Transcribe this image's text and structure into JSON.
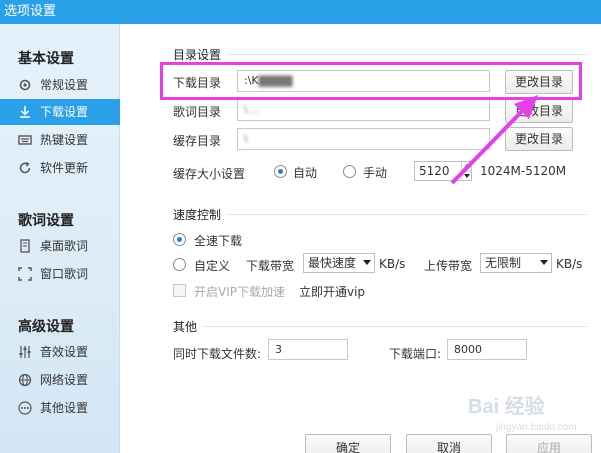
{
  "window": {
    "title": "选项设置"
  },
  "sidebar": {
    "groups": [
      {
        "label": "基本设置",
        "items": [
          {
            "label": "常规设置",
            "icon": "gear-icon"
          },
          {
            "label": "下载设置",
            "icon": "download-icon",
            "active": true
          },
          {
            "label": "热键设置",
            "icon": "keyboard-icon"
          },
          {
            "label": "软件更新",
            "icon": "refresh-icon"
          }
        ]
      },
      {
        "label": "歌词设置",
        "items": [
          {
            "label": "桌面歌词",
            "icon": "desktop-lyrics-icon"
          },
          {
            "label": "窗口歌词",
            "icon": "window-lyrics-icon"
          }
        ]
      },
      {
        "label": "高级设置",
        "items": [
          {
            "label": "音效设置",
            "icon": "equalizer-icon"
          },
          {
            "label": "网络设置",
            "icon": "network-icon"
          },
          {
            "label": "其他设置",
            "icon": "more-icon"
          }
        ]
      }
    ]
  },
  "directory": {
    "section_title": "目录设置",
    "download_label": "下载目录",
    "download_value": ":\\K",
    "lyrics_label": "歌词目录",
    "lyrics_value": "\\ ..",
    "cache_label": "缓存目录",
    "cache_value": "\\",
    "change_button": "更改目录",
    "cache_size_label": "缓存大小设置",
    "auto_label": "自动",
    "manual_label": "手动",
    "cache_size_value": "5120",
    "cache_range": "1024M-5120M"
  },
  "speed": {
    "section_title": "速度控制",
    "full_speed_label": "全速下载",
    "custom_label": "自定义",
    "download_bw_label": "下载带宽",
    "download_bw_value": "最快速度",
    "unit": "KB/s",
    "upload_bw_label": "上传带宽",
    "upload_bw_value": "无限制",
    "vip_label": "开启VIP下载加速",
    "vip_link": "立即开通vip"
  },
  "other": {
    "section_title": "其他",
    "concurrent_label": "同时下载文件数:",
    "concurrent_value": "3",
    "port_label": "下载端口:",
    "port_value": "8000"
  },
  "footer": {
    "ok": "确定",
    "cancel": "取消",
    "apply": "应用"
  },
  "watermark": {
    "text": "Bai 经验",
    "sub": "jingyan.baidu.com"
  },
  "colors": {
    "accent": "#2aa0e8",
    "highlight": "#e43fe8"
  }
}
